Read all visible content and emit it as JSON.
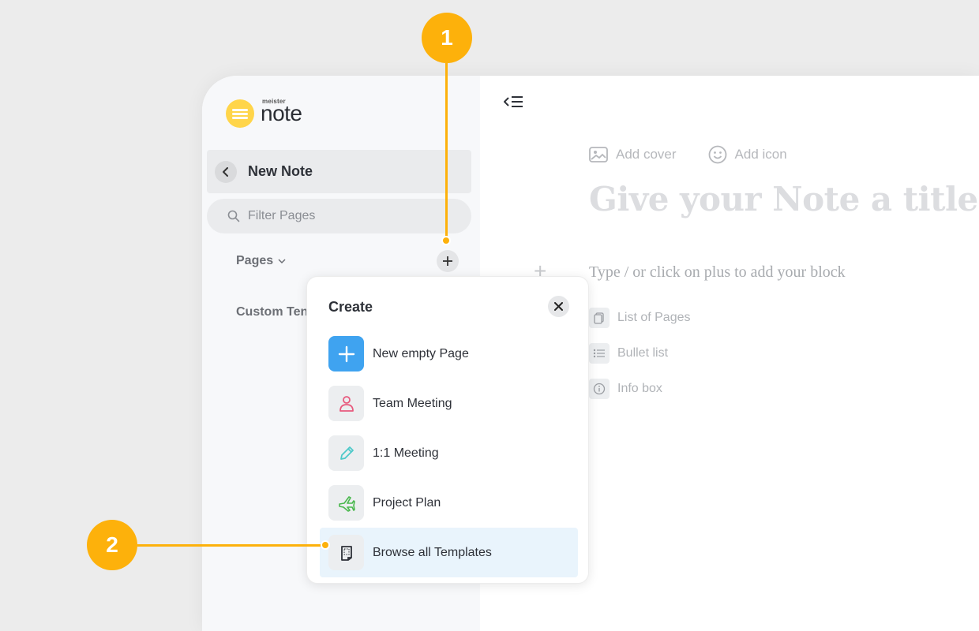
{
  "logo": {
    "small": "meister",
    "big": "note"
  },
  "sidebar": {
    "note_title": "New Note",
    "filter_placeholder": "Filter Pages",
    "pages_label": "Pages",
    "custom_templates_label": "Custom Ten"
  },
  "editor": {
    "add_cover": "Add cover",
    "add_icon": "Add icon",
    "title_placeholder": "Give your Note a title",
    "block_placeholder": "Type / or click on plus to add your block",
    "blocks": [
      {
        "label": "List of Pages",
        "icon": "pages-icon"
      },
      {
        "label": "Bullet list",
        "icon": "bullet-list-icon"
      },
      {
        "label": "Info box",
        "icon": "info-icon"
      }
    ]
  },
  "create_popup": {
    "title": "Create",
    "items": [
      {
        "label": "New empty Page",
        "icon": "plus-icon"
      },
      {
        "label": "Team Meeting",
        "icon": "person-icon"
      },
      {
        "label": "1:1 Meeting",
        "icon": "pencil-icon"
      },
      {
        "label": "Project Plan",
        "icon": "plane-icon"
      },
      {
        "label": "Browse all Templates",
        "icon": "templates-icon"
      }
    ]
  },
  "callouts": {
    "one": "1",
    "two": "2"
  },
  "colors": {
    "accent": "#fdb10b",
    "blue": "#3fa3f0",
    "logo": "#ffd54a",
    "highlight": "#e9f4fc"
  }
}
